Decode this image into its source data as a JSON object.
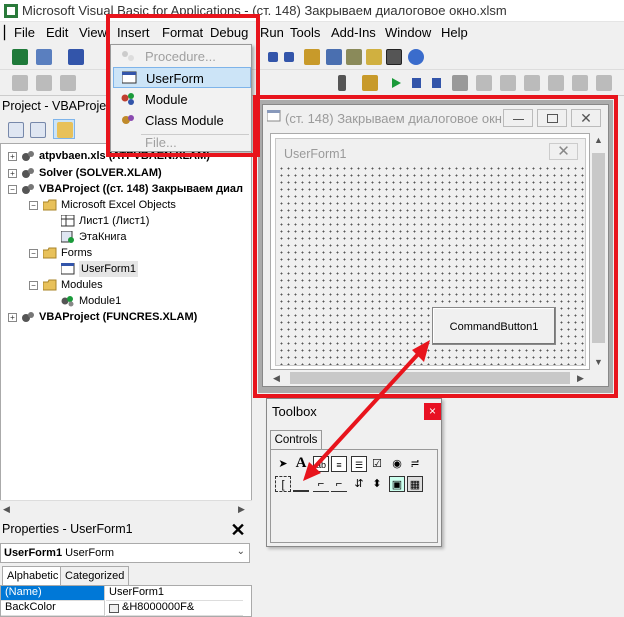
{
  "app": {
    "title": "Microsoft Visual Basic for Applications - (ст. 148) Закрываем диалоговое окно.xlsm"
  },
  "menu": {
    "items": [
      "File",
      "Edit",
      "View",
      "Insert",
      "Format",
      "Debug",
      "Run",
      "Tools",
      "Add-Ins",
      "Window",
      "Help"
    ]
  },
  "insert_menu": {
    "items": [
      {
        "label": "Procedure...",
        "enabled": false,
        "icon": "procedure-icon"
      },
      {
        "label": "UserForm",
        "enabled": true,
        "selected": true,
        "icon": "userform-icon"
      },
      {
        "label": "Module",
        "enabled": true,
        "icon": "module-icon"
      },
      {
        "label": "Class Module",
        "enabled": true,
        "icon": "class-module-icon"
      },
      {
        "label": "File...",
        "enabled": false,
        "icon": ""
      }
    ]
  },
  "project": {
    "title": "Project - VBAProject",
    "tree": [
      {
        "label": "atpvbaen.xls (ATPVBAEN.XLAM)",
        "bold": true
      },
      {
        "label": "Solver (SOLVER.XLAM)",
        "bold": true
      },
      {
        "label": "VBAProject ((ст. 148) Закрываем диал",
        "bold": true
      },
      {
        "label": "Microsoft Excel Objects",
        "bold": false
      },
      {
        "label": "Лист1 (Лист1)",
        "bold": false
      },
      {
        "label": "ЭтаКнига",
        "bold": false
      },
      {
        "label": "Forms",
        "bold": false
      },
      {
        "label": "UserForm1",
        "bold": false
      },
      {
        "label": "Modules",
        "bold": false
      },
      {
        "label": "Module1",
        "bold": false
      },
      {
        "label": "VBAProject (FUNCRES.XLAM)",
        "bold": true
      }
    ]
  },
  "properties": {
    "title": "Properties - UserForm1",
    "object_name": "UserForm1",
    "object_type": "UserForm",
    "tabs": [
      "Alphabetic",
      "Categorized"
    ],
    "rows": [
      {
        "key": "(Name)",
        "value": "UserForm1"
      },
      {
        "key": "BackColor",
        "value": "&H8000000F&"
      }
    ]
  },
  "form_window": {
    "title": "(ст. 148) Закрываем диалоговое окн...",
    "userform_caption": "UserForm1",
    "button_caption": "CommandButton1"
  },
  "toolbox": {
    "title": "Toolbox",
    "close": "×",
    "tab": "Controls"
  },
  "colors": {
    "highlight": "#e8141c",
    "selection": "#cce4f7",
    "arrow": "#e8141c"
  }
}
